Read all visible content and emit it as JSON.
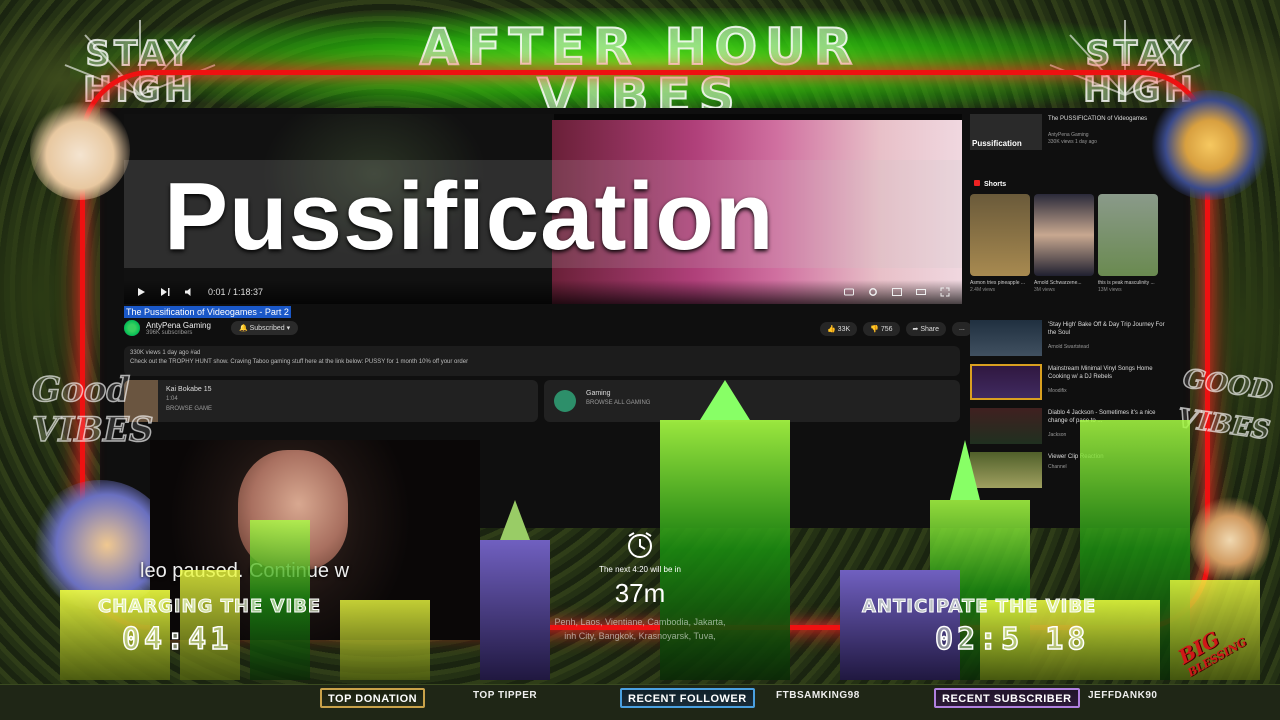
{
  "overlay": {
    "banner_line1": "AFTER HOUR",
    "banner_line2": "VIBES",
    "stay_high_left_1": "STAY",
    "stay_high_left_2": "HIGH",
    "stay_high_right_1": "STAY",
    "stay_high_right_2": "HIGH",
    "good_vibes_left_1": "Good",
    "good_vibes_left_2": "VIBES",
    "good_vibes_right_1": "GOOD",
    "good_vibes_right_2": "VIBES",
    "big_blessing_1": "BIG",
    "big_blessing_2": "BLESSING",
    "accent_color": "#39ff14",
    "frame_color": "#e11111"
  },
  "video": {
    "overlay_title": "Pussification",
    "time": "0:01 / 1:18:37",
    "title": "The Pussification of Videogames - Part 2",
    "channel_name": "AntyPena Gaming",
    "channel_subs": "396K subscribers",
    "subscribe_label": "Subscribed",
    "like_label": "33K",
    "dislike_label": "756",
    "share_label": "Share",
    "more_label": "...",
    "desc_line1": "330K views  1 day ago  #ad",
    "desc_line2": "Check out the TROPHY HUNT show. Craving Taboo gaming stuff here at the link below: PUSSY for 1 month 10% off your order",
    "card1_title": "Kai Bokabe 15",
    "card1_sub": "1:04",
    "card1_sub2": "BROWSE GAME",
    "card2_title": "Gaming",
    "card2_sub": "BROWSE ALL GAMING"
  },
  "sidebar": {
    "top_title": "The PUSSIFICATION of Videogames",
    "top_sub": "AntyPena Gaming",
    "top_sub2": "330K views  1 day ago",
    "top_thumb_label": "Pussification",
    "shorts_label": "Shorts",
    "shorts": [
      {
        "title": "Asmon tries pineapple ...",
        "views": "2.4M views"
      },
      {
        "title": "Arnold Schwarzene...",
        "views": "3M views"
      },
      {
        "title": "this is peak masculinity ...",
        "views": "13M views"
      }
    ],
    "videos": [
      {
        "title": "'Stay High' Bake Off & Day Trip Journey For the Soul",
        "sub": "Arnold Swartstead"
      },
      {
        "title": "Mainstream Minimal Vinyl Songs Home Cooking w/ a DJ Rebels",
        "sub": "Moodifix"
      },
      {
        "title": "Diablo 4 Jackson - Sometimes it's a nice change of pace to ...",
        "sub": "Jackson"
      },
      {
        "title": "Viewer Clip Reaction",
        "sub": "Channel"
      }
    ]
  },
  "webcam": {
    "paused_message": "leo paused. Continue w"
  },
  "clock": {
    "next_label": "The next 4:20 will be in",
    "minutes": "37m",
    "places_1": "Penh, Laos, Vientiane, Cambodia, Jakarta,",
    "places_2": "inh City, Bangkok, Krasnoyarsk, Tuva,"
  },
  "timers": {
    "left_label": "CHARGING THE VIBE",
    "left_value": "04:41",
    "right_label": "ANTICIPATE THE VIBE",
    "right_value": "02:5 18"
  },
  "ticker": {
    "top_donation_label": "TOP DONATION",
    "top_tipper_label": "TOP TIPPER",
    "recent_follower_label": "RECENT FOLLOWER",
    "recent_follower_value": "FTBSAMKING98",
    "recent_subscriber_label": "RECENT SUBSCRIBER",
    "recent_subscriber_value": "JEFFDANK90"
  }
}
